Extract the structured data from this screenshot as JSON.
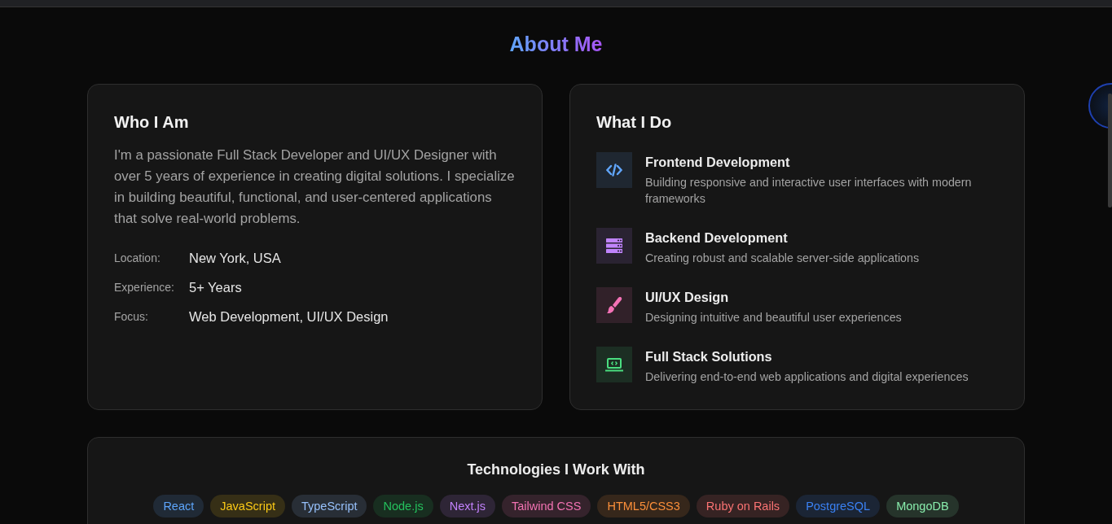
{
  "title": "About Me",
  "who": {
    "heading": "Who I Am",
    "paragraph": "I'm a passionate Full Stack Developer and UI/UX Designer with over 5 years of experience in creating digital solutions. I specialize in building beautiful, functional, and user-centered applications that solve real-world problems.",
    "facts": [
      {
        "label": "Location:",
        "value": "New York, USA"
      },
      {
        "label": "Experience:",
        "value": "5+ Years"
      },
      {
        "label": "Focus:",
        "value": "Web Development, UI/UX Design"
      }
    ]
  },
  "what": {
    "heading": "What I Do",
    "services": [
      {
        "kind": "code",
        "color": "#60a5fa",
        "title": "Frontend Development",
        "description": "Building responsive and interactive user interfaces with modern frameworks"
      },
      {
        "kind": "server",
        "color": "#c084fc",
        "title": "Backend Development",
        "description": "Creating robust and scalable server-side applications"
      },
      {
        "kind": "brush",
        "color": "#f472b6",
        "title": "UI/UX Design",
        "description": "Designing intuitive and beautiful user experiences"
      },
      {
        "kind": "laptop",
        "color": "#4ade80",
        "title": "Full Stack Solutions",
        "description": "Delivering end-to-end web applications and digital experiences"
      }
    ]
  },
  "technologies": {
    "heading": "Technologies I Work With",
    "tags": [
      {
        "label": "React",
        "color": "#202a36"
      },
      {
        "label": "JavaScript",
        "color": "#362f16"
      },
      {
        "label": "TypeScript",
        "color": "#282e36"
      },
      {
        "label": "Node.js",
        "color": "#182e20"
      },
      {
        "label": "Next.js",
        "color": "#2e2536"
      },
      {
        "label": "Tailwind CSS",
        "color": "#35232c"
      },
      {
        "label": "HTML5/CSS3",
        "color": "#36271b"
      },
      {
        "label": "Ruby on Rails",
        "color": "#362323"
      },
      {
        "label": "PostgreSQL",
        "color": "#1b2535"
      },
      {
        "label": "MongoDB",
        "color": "#26342b"
      }
    ]
  }
}
